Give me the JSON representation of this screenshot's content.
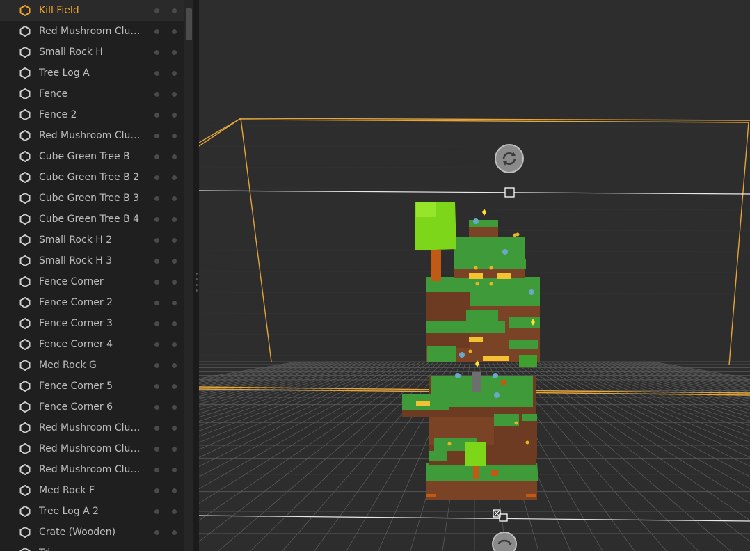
{
  "hierarchy": {
    "items": [
      {
        "label": "Kill Field",
        "selected": true
      },
      {
        "label": "Red Mushroom Clus…"
      },
      {
        "label": "Small Rock H"
      },
      {
        "label": "Tree Log A"
      },
      {
        "label": "Fence"
      },
      {
        "label": "Fence 2"
      },
      {
        "label": "Red Mushroom Clus…"
      },
      {
        "label": "Cube Green Tree B"
      },
      {
        "label": "Cube Green Tree B 2"
      },
      {
        "label": "Cube Green Tree B 3"
      },
      {
        "label": "Cube Green Tree B 4"
      },
      {
        "label": "Small Rock H 2"
      },
      {
        "label": "Small Rock H 3"
      },
      {
        "label": "Fence Corner"
      },
      {
        "label": "Fence Corner 2"
      },
      {
        "label": "Fence Corner 3"
      },
      {
        "label": "Fence Corner 4"
      },
      {
        "label": "Med Rock G"
      },
      {
        "label": "Fence Corner 5"
      },
      {
        "label": "Fence Corner 6"
      },
      {
        "label": "Red Mushroom Clus…"
      },
      {
        "label": "Red Mushroom Clus…"
      },
      {
        "label": "Red Mushroom Clus…"
      },
      {
        "label": "Med Rock F"
      },
      {
        "label": "Tree Log A 2"
      },
      {
        "label": "Crate (Wooden)"
      },
      {
        "label": "Tri…"
      }
    ],
    "icon": "hexagon-object-icon"
  },
  "colors": {
    "accent": "#f0a52a",
    "panel_bg": "#1f1f1f",
    "viewport_bg": "#2d2d2d",
    "grass": "#3f9a3a",
    "dirt": "#7a4326"
  }
}
